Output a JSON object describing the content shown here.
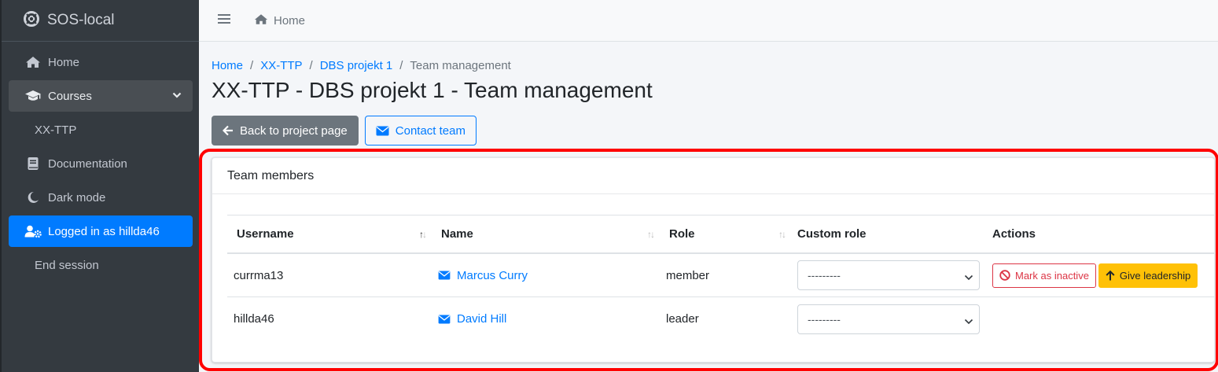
{
  "brand": {
    "title": "SOS-local"
  },
  "sidebar": {
    "items": [
      {
        "label": "Home",
        "icon": "home-icon"
      },
      {
        "label": "Courses",
        "icon": "graduation-cap-icon"
      },
      {
        "label": "XX-TTP"
      },
      {
        "label": "Documentation",
        "icon": "book-icon"
      },
      {
        "label": "Dark mode",
        "icon": "moon-icon"
      },
      {
        "label": "Logged in as hillda46",
        "icon": "user-cog-icon"
      },
      {
        "label": "End session"
      }
    ]
  },
  "topbar": {
    "home_label": "Home"
  },
  "breadcrumb": {
    "items": [
      "Home",
      "XX-TTP",
      "DBS projekt 1"
    ],
    "current": "Team management"
  },
  "page": {
    "title": "XX-TTP - DBS projekt 1 - Team management"
  },
  "buttons": {
    "back": "Back to project page",
    "contact": "Contact team"
  },
  "card": {
    "title": "Team members"
  },
  "table": {
    "headers": [
      "Username",
      "Name",
      "Role",
      "Custom role",
      "Actions"
    ],
    "rows": [
      {
        "username": "currma13",
        "name": "Marcus Curry",
        "role": "member",
        "custom_role": "---------",
        "actions": [
          "Mark as inactive",
          "Give leadership"
        ]
      },
      {
        "username": "hillda46",
        "name": "David Hill",
        "role": "leader",
        "custom_role": "---------"
      }
    ]
  },
  "colors": {
    "primary": "#007bff",
    "sidebar": "#343a40",
    "danger": "#dc3545",
    "warning": "#ffc107",
    "highlight": "#ff0000"
  }
}
